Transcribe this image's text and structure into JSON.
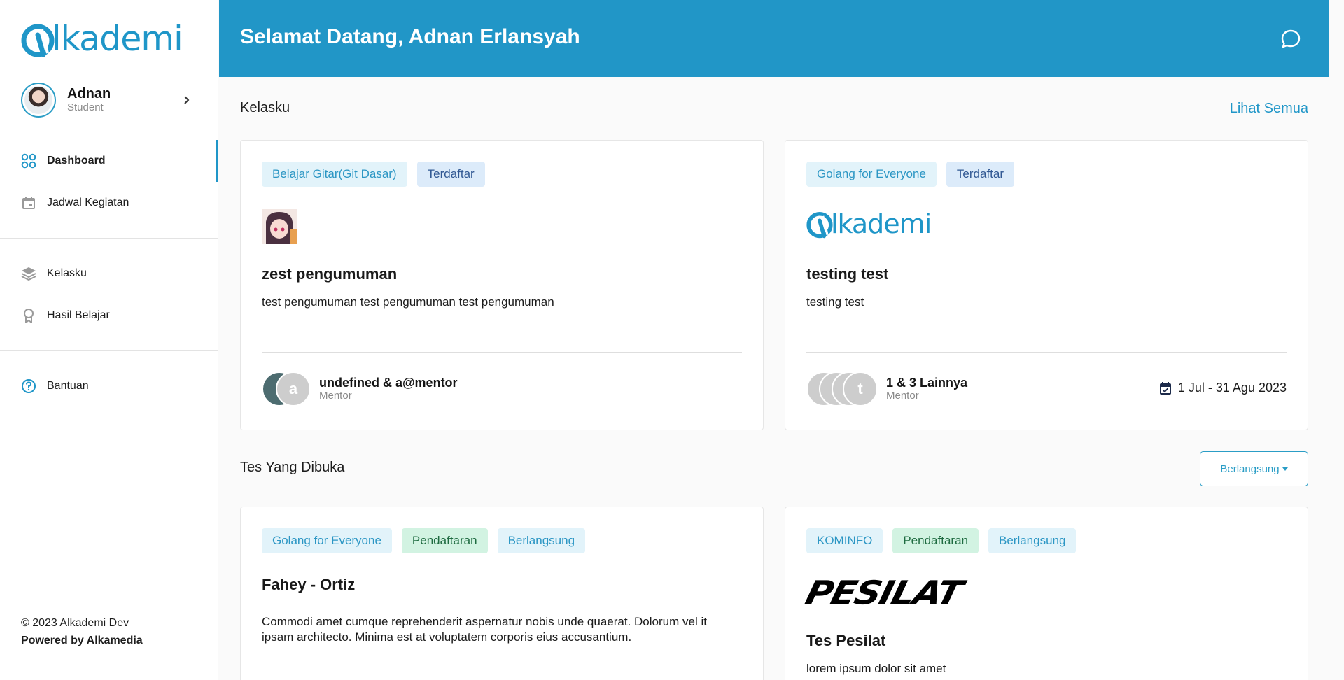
{
  "brand": {
    "name": "Alkademi",
    "accent": "#1f96c8",
    "header_bg": "#2196c7"
  },
  "profile": {
    "name": "Adnan",
    "role": "Student"
  },
  "nav": {
    "primary": [
      {
        "label": "Dashboard",
        "icon": "grid-icon",
        "active": true
      },
      {
        "label": "Jadwal Kegiatan",
        "icon": "calendar-icon",
        "active": false
      }
    ],
    "secondary": [
      {
        "label": "Kelasku",
        "icon": "layers-icon"
      },
      {
        "label": "Hasil Belajar",
        "icon": "award-icon"
      }
    ],
    "help": {
      "label": "Bantuan",
      "icon": "help-circle-icon"
    }
  },
  "footer": {
    "copyright": "© 2023 Alkademi Dev",
    "powered": "Powered by Alkamedia"
  },
  "header": {
    "welcome": "Selamat Datang, Adnan Erlansyah"
  },
  "kelasku": {
    "title": "Kelasku",
    "see_all": "Lihat Semua",
    "cards": [
      {
        "tags": [
          "Belajar Gitar(Git Dasar)",
          "Terdaftar"
        ],
        "title": "zest pengumuman",
        "description": "test pengumuman test pengumuman test pengumuman",
        "mentor_names": "undefined & a@mentor",
        "mentor_role": "Mentor",
        "bubble_letter": "a"
      },
      {
        "tags": [
          "Golang for Everyone",
          "Terdaftar"
        ],
        "logo_text": "Alkademi",
        "title": "testing test",
        "description": "testing test",
        "mentor_names": "1 & 3 Lainnya",
        "mentor_role": "Mentor",
        "bubble_letter": "t",
        "date": "1 Jul - 31 Agu 2023"
      }
    ]
  },
  "tests": {
    "title": "Tes Yang Dibuka",
    "filter": "Berlangsung",
    "cards": [
      {
        "tags": [
          "Golang for Everyone",
          "Pendaftaran",
          "Berlangsung"
        ],
        "title": "Fahey - Ortiz",
        "description": "Commodi amet cumque reprehenderit aspernatur nobis unde quaerat. Dolorum vel it ipsam architecto. Minima est at voluptatem corporis eius accusantium."
      },
      {
        "tags": [
          "KOMINFO",
          "Pendaftaran",
          "Berlangsung"
        ],
        "logo_text": "PESILAT",
        "title": "Tes Pesilat",
        "description": "lorem ipsum dolor sit amet"
      }
    ]
  }
}
